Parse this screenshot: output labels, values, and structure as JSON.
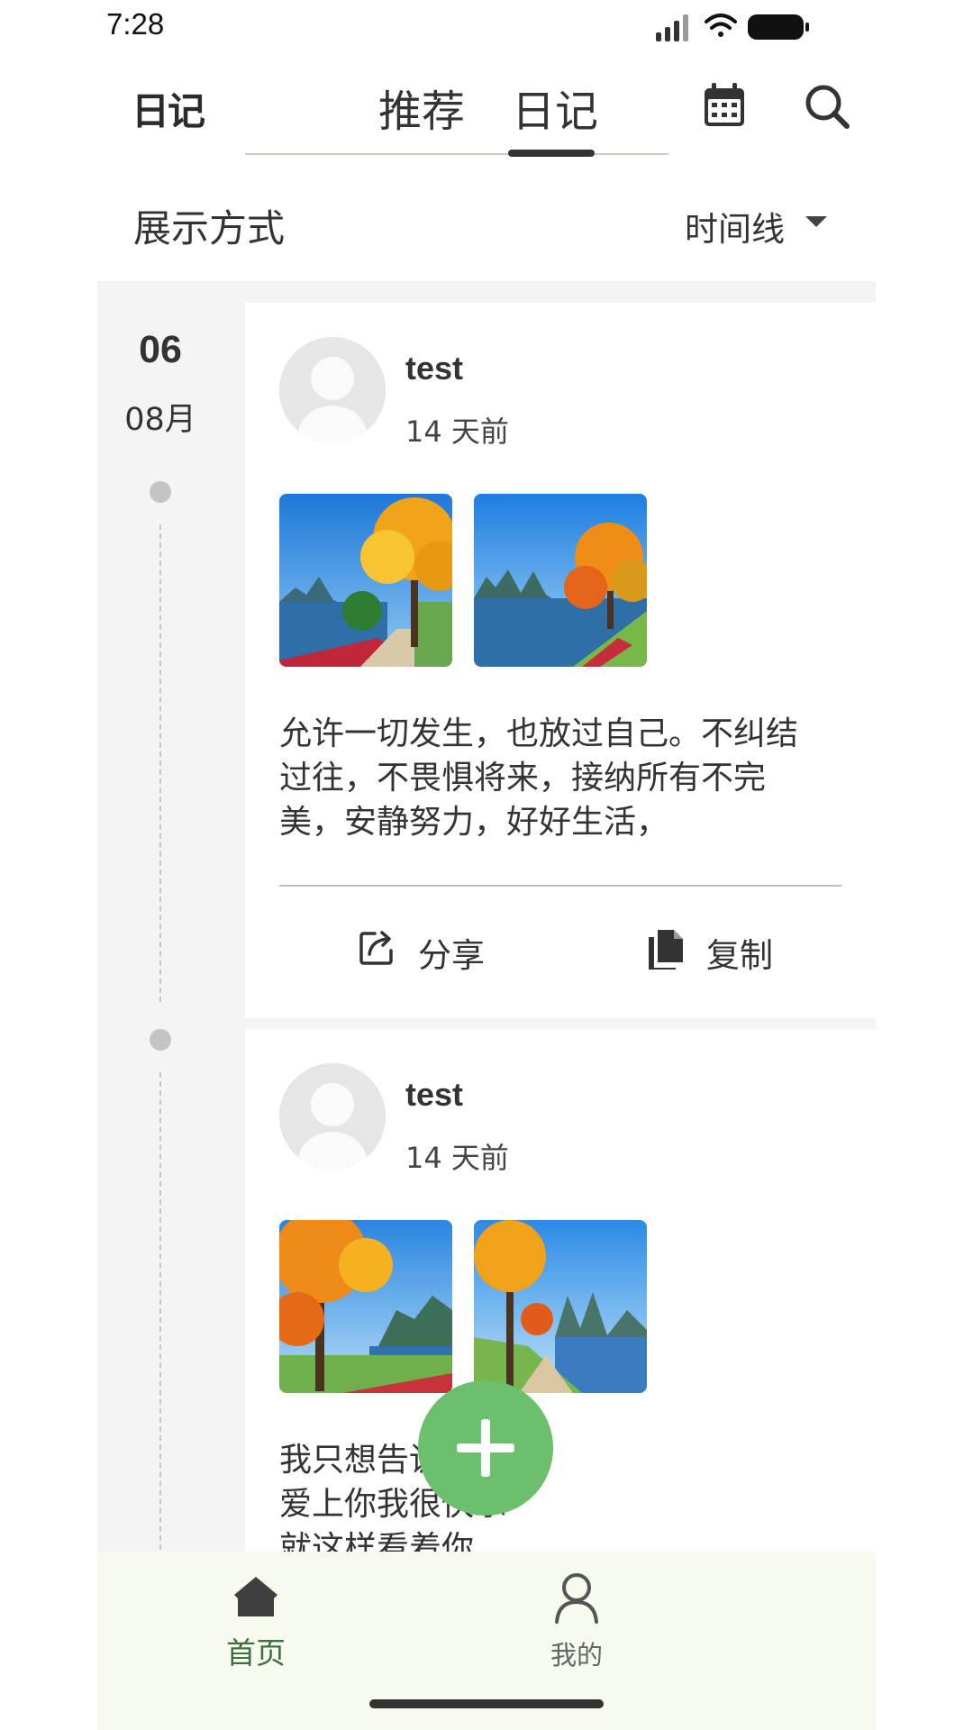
{
  "status_bar": {
    "time": "7:28"
  },
  "header": {
    "logo": "日记",
    "tabs": [
      {
        "label": "推荐",
        "active": false
      },
      {
        "label": "日记",
        "active": true
      }
    ],
    "icons": [
      "calendar-icon",
      "search-icon"
    ]
  },
  "display_mode": {
    "label": "展示方式",
    "selected": "时间线"
  },
  "timeline": {
    "day": "06",
    "month": "08月"
  },
  "entries": [
    {
      "author": "test",
      "time_ago": "14 天前",
      "text": "允许一切发生，也放过自己。不纠结过往，不畏惧将来，接纳所有不完美，安静努力，好好生活，",
      "actions": {
        "share": "分享",
        "copy": "复制"
      }
    },
    {
      "author": "test",
      "time_ago": "14 天前",
      "text": "我只想告诉你\n爱上你我很快乐\n就这样看着你"
    }
  ],
  "bottom_nav": [
    {
      "label": "首页",
      "icon": "home-icon",
      "active": true
    },
    {
      "label": "我的",
      "icon": "user-icon",
      "active": false
    }
  ],
  "colors": {
    "accent": "#6cbf6c",
    "active_nav": "#3f6e3f",
    "nav_bg": "#f6faef",
    "content_bg": "#f4f4f4"
  }
}
